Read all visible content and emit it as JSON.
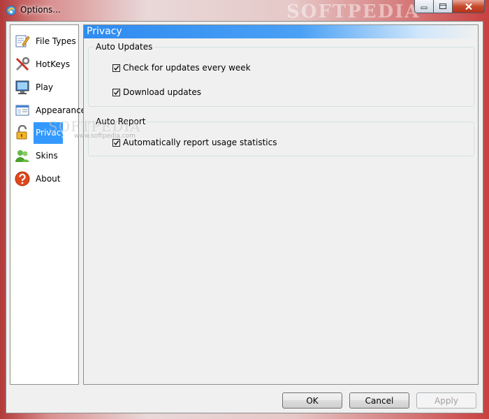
{
  "window": {
    "title": "Options...",
    "watermark": "SOFTPEDIA"
  },
  "sidebar": {
    "items": [
      {
        "label": "File Types",
        "icon": "file-types-icon"
      },
      {
        "label": "HotKeys",
        "icon": "hotkeys-icon"
      },
      {
        "label": "Play",
        "icon": "monitor-icon"
      },
      {
        "label": "Appearance",
        "icon": "appearance-icon"
      },
      {
        "label": "Privacy",
        "icon": "lock-icon",
        "selected": true
      },
      {
        "label": "Skins",
        "icon": "users-icon"
      },
      {
        "label": "About",
        "icon": "help-icon"
      }
    ]
  },
  "content": {
    "watermark": "SOFTPEDIA",
    "watermark_url": "www.softpedia.com",
    "section_title": "Privacy",
    "groups": [
      {
        "label": "Auto Updates",
        "options": [
          {
            "label": "Check for updates every week",
            "checked": true
          },
          {
            "label": "Download updates",
            "checked": true
          }
        ]
      },
      {
        "label": "Auto Report",
        "options": [
          {
            "label": "Automatically report usage statistics",
            "checked": true
          }
        ]
      }
    ]
  },
  "footer": {
    "ok_label": "OK",
    "cancel_label": "Cancel",
    "apply_label": "Apply",
    "apply_enabled": false
  },
  "colors": {
    "selection": "#3399ff",
    "header_gradient_start": "#2e8bf0"
  }
}
